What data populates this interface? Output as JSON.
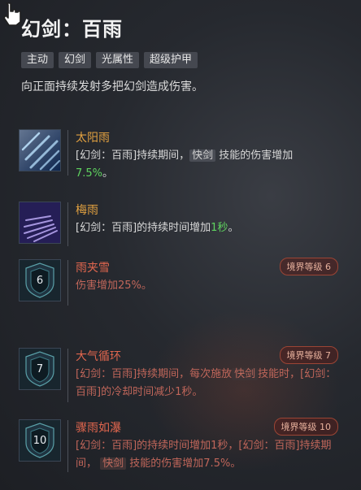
{
  "skill": {
    "title": "幻剑：百雨",
    "tags": [
      "主动",
      "幻剑",
      "光属性",
      "超级护甲"
    ],
    "description": "向正面持续发射多把幻剑造成伤害。"
  },
  "upgrades": [
    {
      "name": "太阳雨",
      "parts": {
        "a": "[幻剑：百雨]持续期间，",
        "kw": "快剑",
        "b": " 技能的伤害增加",
        "green": "7.5%",
        "c": "。"
      }
    },
    {
      "name": "梅雨",
      "parts": {
        "a": "[幻剑：百雨]的持续时间增加",
        "green": "1秒",
        "b": "。"
      }
    },
    {
      "name": "雨夹雪",
      "badge": "境界等级 6",
      "level_number": "6",
      "text": "伤害增加25%。"
    },
    {
      "name": "大气循环",
      "badge": "境界等级 7",
      "level_number": "7",
      "parts": {
        "a": "[幻剑：百雨]持续期间，每次施放",
        "kw": "快剑",
        "b": "技能时，[幻剑：百雨]的冷却时间减少1秒。"
      }
    },
    {
      "name": "骤雨如瀑",
      "badge": "境界等级 10",
      "level_number": "10",
      "parts": {
        "a": "[幻剑：百雨]的持续时间增加1秒，[幻剑：百雨]持续期间， ",
        "kw": "快剑",
        "b": " 技能的伤害增加7.5%。"
      }
    }
  ],
  "colors": {
    "locked_name": "#e0664e",
    "highlight_green": "#5fd35f",
    "badge_border": "#9c4535",
    "unlocked_name": "#e0a040"
  },
  "icons": [
    "hand-cursor-icon",
    "sun-rain-icon",
    "plum-rain-icon",
    "level-shield-icon"
  ]
}
